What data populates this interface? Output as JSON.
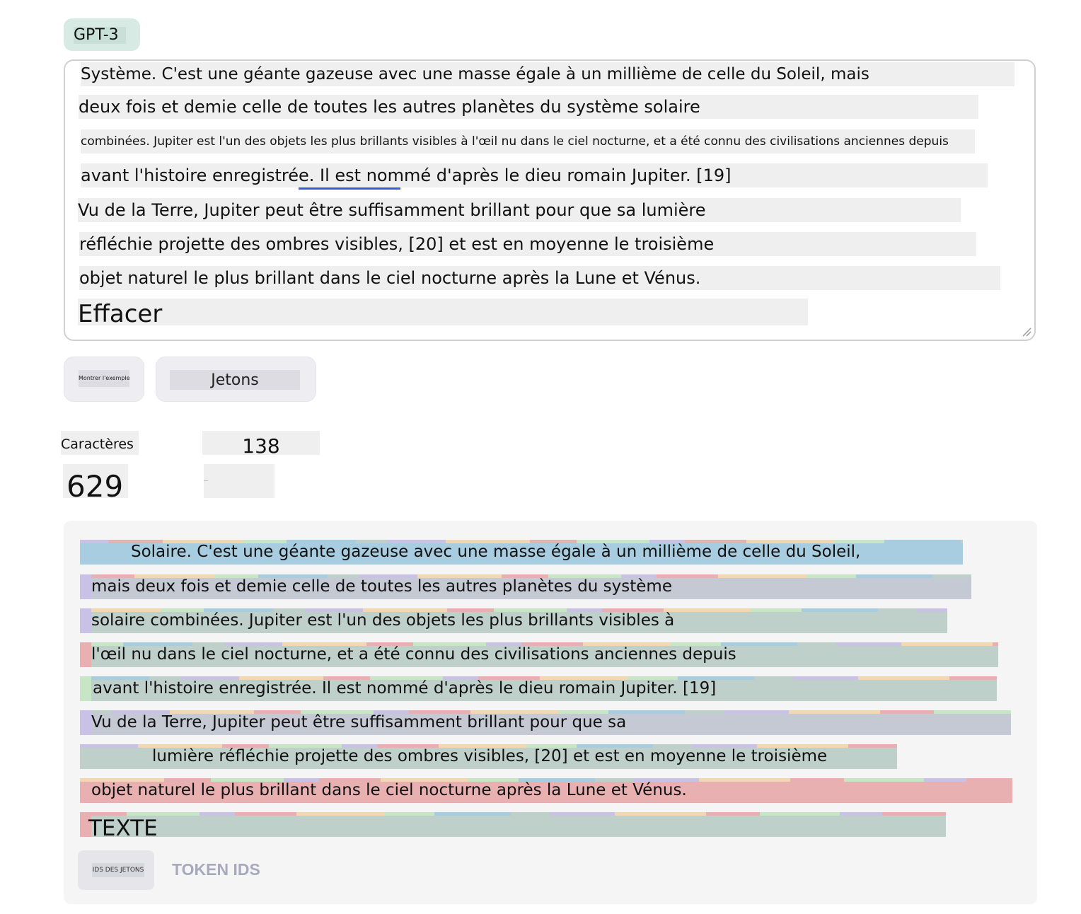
{
  "model_tab": {
    "label": "GPT-3"
  },
  "editor": {
    "lines": [
      "Système. C'est une géante gazeuse avec une masse égale à un millième de celle du Soleil, mais",
      "deux fois et demie celle de toutes les autres planètes du système solaire",
      "combinées. Jupiter est l'un des objets les plus brillants visibles à l'œil nu dans le ciel nocturne, et a été connu des civilisations anciennes depuis",
      "avant l'histoire enregistrée. Il est nommé d'après le dieu romain Jupiter. [19]",
      "Vu de la Terre, Jupiter peut être suffisamment brillant pour que sa lumière",
      "réfléchie projette des ombres visibles, [20] et est en moyenne le troisième",
      "objet naturel le plus brillant dans le ciel nocturne après la Lune et Vénus.",
      "Effacer"
    ]
  },
  "buttons": {
    "show_example": "Montrer l'exemple",
    "tokens": "Jetons"
  },
  "stats": {
    "characters_label": "Caractères",
    "tokens_value": "138",
    "characters_value": "629",
    "tokens_label": "Jetons"
  },
  "output": {
    "lines": [
      "Solaire. C'est une géante gazeuse avec une masse égale à un millième de celle du Soleil,",
      "mais deux fois et demie celle de toutes les autres planètes du système",
      "solaire combinées. Jupiter est l'un des objets les plus brillants visibles à",
      "l'œil nu dans le ciel nocturne, et a été connu des civilisations anciennes depuis",
      "avant l'histoire enregistrée. Il est nommé d'après le dieu romain Jupiter. [19]",
      "Vu de la Terre, Jupiter peut être suffisamment brillant pour que sa",
      "lumière réfléchie projette des ombres visibles, [20] et est en moyenne le troisième",
      "objet naturel le plus brillant dans le ciel nocturne après la Lune et Vénus.",
      "TEXTE"
    ],
    "colors": {
      "blue": "#a9cde0",
      "purple": "#c9c2e6",
      "green": "#bfcfc9",
      "red": "#e8b0b0",
      "orange": "#f3d7b0",
      "mint": "#c6e6c6",
      "gray": "#c4c9d3"
    },
    "ids_button": "IDS DES JETONS",
    "token_ids_toggle": "TOKEN IDS"
  }
}
